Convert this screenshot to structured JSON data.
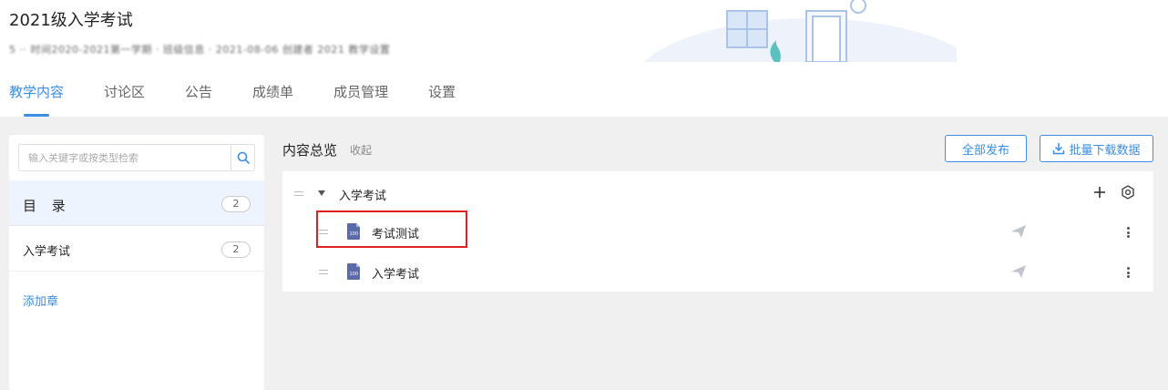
{
  "course": {
    "title": "2021级入学考试",
    "meta": "5 ·· 时间2020-2021第一学期 · 班级信息 · 2021-08-06 创建者 2021 教学设置"
  },
  "tabs": [
    {
      "label": "教学内容",
      "active": true
    },
    {
      "label": "讨论区",
      "active": false
    },
    {
      "label": "公告",
      "active": false
    },
    {
      "label": "成绩单",
      "active": false
    },
    {
      "label": "成员管理",
      "active": false
    },
    {
      "label": "设置",
      "active": false
    }
  ],
  "sidebar": {
    "search": {
      "placeholder": "输入关键字或按类型检索",
      "value": ""
    },
    "catalog": {
      "label": "目 录",
      "count": "2"
    },
    "chapters": [
      {
        "label": "入学考试",
        "count": "2"
      }
    ],
    "add_chapter_label": "添加章"
  },
  "main": {
    "title": "内容总览",
    "collapse_label": "收起",
    "publish_all_label": "全部发布",
    "batch_download_label": "批量下载数据",
    "section": {
      "title": "入学考试",
      "items": [
        {
          "title": "考试测试",
          "highlighted": true,
          "icon": "document-icon"
        },
        {
          "title": "入学考试",
          "highlighted": false,
          "icon": "document-icon"
        }
      ]
    }
  },
  "colors": {
    "accent": "#3a8ee6",
    "highlight": "#e02020",
    "doc_icon": "#5b6aa8"
  }
}
